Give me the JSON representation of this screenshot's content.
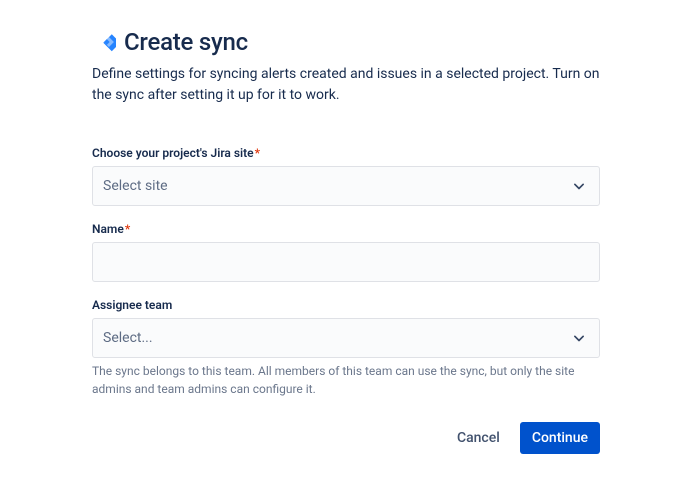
{
  "header": {
    "title": "Create sync",
    "description": "Define settings for syncing alerts created and issues in a selected project. Turn on the sync after setting it up for it to work."
  },
  "fields": {
    "site": {
      "label": "Choose your project's Jira site",
      "required": "*",
      "placeholder": "Select site"
    },
    "name": {
      "label": "Name",
      "required": "*",
      "value": ""
    },
    "assignee": {
      "label": "Assignee team",
      "placeholder": "Select...",
      "helper": "The sync belongs to this team. All members of this team can use the sync, but only the site admins and team admins can configure it."
    }
  },
  "footer": {
    "cancel": "Cancel",
    "continue": "Continue"
  }
}
